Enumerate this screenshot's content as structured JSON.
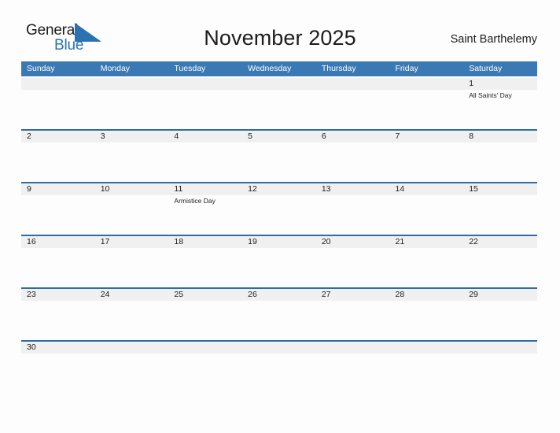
{
  "brand": {
    "name_top": "General",
    "name_bottom": "Blue",
    "flag_icon": "blue-triangle-flag-icon",
    "color_top": "#1c1c1c",
    "color_bottom": "#2b72b0"
  },
  "header": {
    "title": "November 2025",
    "locale": "Saint Barthelemy"
  },
  "colors": {
    "header_blue": "#3a79b4",
    "rule_blue": "#2e6da4",
    "date_band_gray": "#f0f0f0",
    "page_background": "#fdfdfd",
    "text": "#1c1c1c"
  },
  "calendar": {
    "month": "November",
    "year": "2025",
    "weekdays": [
      "Sunday",
      "Monday",
      "Tuesday",
      "Wednesday",
      "Thursday",
      "Friday",
      "Saturday"
    ],
    "weeks": [
      [
        {
          "day": "",
          "events": []
        },
        {
          "day": "",
          "events": []
        },
        {
          "day": "",
          "events": []
        },
        {
          "day": "",
          "events": []
        },
        {
          "day": "",
          "events": []
        },
        {
          "day": "",
          "events": []
        },
        {
          "day": "1",
          "events": [
            "All Saints' Day"
          ]
        }
      ],
      [
        {
          "day": "2",
          "events": []
        },
        {
          "day": "3",
          "events": []
        },
        {
          "day": "4",
          "events": []
        },
        {
          "day": "5",
          "events": []
        },
        {
          "day": "6",
          "events": []
        },
        {
          "day": "7",
          "events": []
        },
        {
          "day": "8",
          "events": []
        }
      ],
      [
        {
          "day": "9",
          "events": []
        },
        {
          "day": "10",
          "events": []
        },
        {
          "day": "11",
          "events": [
            "Armistice Day"
          ]
        },
        {
          "day": "12",
          "events": []
        },
        {
          "day": "13",
          "events": []
        },
        {
          "day": "14",
          "events": []
        },
        {
          "day": "15",
          "events": []
        }
      ],
      [
        {
          "day": "16",
          "events": []
        },
        {
          "day": "17",
          "events": []
        },
        {
          "day": "18",
          "events": []
        },
        {
          "day": "19",
          "events": []
        },
        {
          "day": "20",
          "events": []
        },
        {
          "day": "21",
          "events": []
        },
        {
          "day": "22",
          "events": []
        }
      ],
      [
        {
          "day": "23",
          "events": []
        },
        {
          "day": "24",
          "events": []
        },
        {
          "day": "25",
          "events": []
        },
        {
          "day": "26",
          "events": []
        },
        {
          "day": "27",
          "events": []
        },
        {
          "day": "28",
          "events": []
        },
        {
          "day": "29",
          "events": []
        }
      ],
      [
        {
          "day": "30",
          "events": []
        },
        {
          "day": "",
          "events": []
        },
        {
          "day": "",
          "events": []
        },
        {
          "day": "",
          "events": []
        },
        {
          "day": "",
          "events": []
        },
        {
          "day": "",
          "events": []
        },
        {
          "day": "",
          "events": []
        }
      ]
    ]
  }
}
